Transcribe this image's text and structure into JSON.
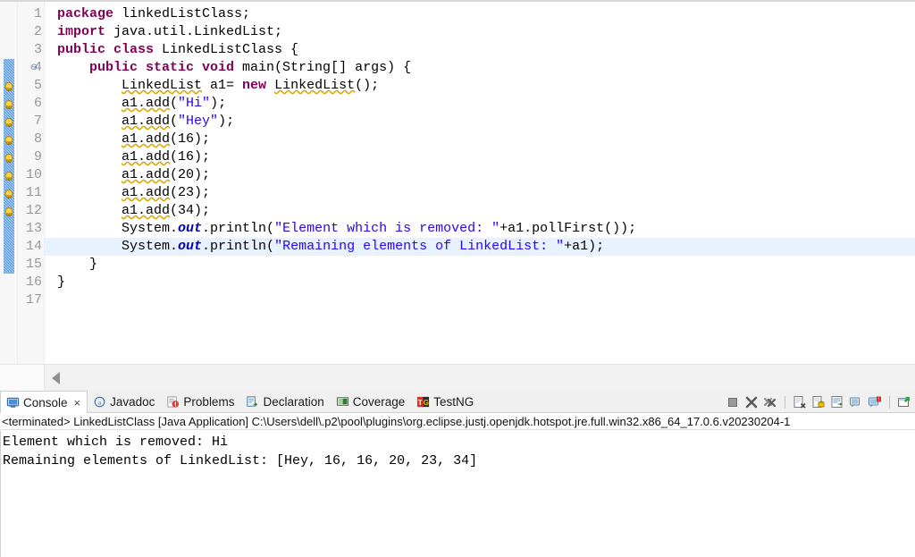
{
  "editor": {
    "name": "java-code-editor",
    "current_line": 14,
    "change_bar": {
      "from_line": 4,
      "to_line": 15
    },
    "warning_lines": [
      5,
      6,
      7,
      8,
      9,
      10,
      11,
      12
    ],
    "fold_marker_line": 4,
    "fold_marker_glyph": "⊖",
    "line_numbers": [
      "1",
      "2",
      "3",
      "4",
      "5",
      "6",
      "7",
      "8",
      "9",
      "10",
      "11",
      "12",
      "13",
      "14",
      "15",
      "16",
      "17"
    ],
    "lines": [
      {
        "n": 1,
        "tokens": [
          {
            "t": "package ",
            "c": "kw"
          },
          {
            "t": "linkedListClass;",
            "c": "plain"
          }
        ]
      },
      {
        "n": 2,
        "tokens": [
          {
            "t": "import ",
            "c": "kw"
          },
          {
            "t": "java.util.LinkedList;",
            "c": "plain"
          }
        ]
      },
      {
        "n": 3,
        "tokens": [
          {
            "t": "public class ",
            "c": "kw"
          },
          {
            "t": "LinkedListClass {",
            "c": "plain"
          }
        ]
      },
      {
        "n": 4,
        "tokens": [
          {
            "t": "    ",
            "c": "plain"
          },
          {
            "t": "public static void ",
            "c": "kw"
          },
          {
            "t": "main(String[] args) {",
            "c": "plain"
          }
        ]
      },
      {
        "n": 5,
        "tokens": [
          {
            "t": "        ",
            "c": "plain"
          },
          {
            "t": "LinkedList",
            "c": "plain warn-u"
          },
          {
            "t": " a1= ",
            "c": "plain"
          },
          {
            "t": "new ",
            "c": "kw"
          },
          {
            "t": "LinkedList",
            "c": "plain warn-u"
          },
          {
            "t": "();",
            "c": "plain"
          }
        ]
      },
      {
        "n": 6,
        "tokens": [
          {
            "t": "        ",
            "c": "plain"
          },
          {
            "t": "a1.add",
            "c": "plain warn-u"
          },
          {
            "t": "(",
            "c": "plain"
          },
          {
            "t": "\"Hi\"",
            "c": "str"
          },
          {
            "t": ");",
            "c": "plain"
          }
        ]
      },
      {
        "n": 7,
        "tokens": [
          {
            "t": "        ",
            "c": "plain"
          },
          {
            "t": "a1.add",
            "c": "plain warn-u"
          },
          {
            "t": "(",
            "c": "plain"
          },
          {
            "t": "\"Hey\"",
            "c": "str"
          },
          {
            "t": ");",
            "c": "plain"
          }
        ]
      },
      {
        "n": 8,
        "tokens": [
          {
            "t": "        ",
            "c": "plain"
          },
          {
            "t": "a1.add",
            "c": "plain warn-u"
          },
          {
            "t": "(16);",
            "c": "plain"
          }
        ]
      },
      {
        "n": 9,
        "tokens": [
          {
            "t": "        ",
            "c": "plain"
          },
          {
            "t": "a1.add",
            "c": "plain warn-u"
          },
          {
            "t": "(16);",
            "c": "plain"
          }
        ]
      },
      {
        "n": 10,
        "tokens": [
          {
            "t": "        ",
            "c": "plain"
          },
          {
            "t": "a1.add",
            "c": "plain warn-u"
          },
          {
            "t": "(20);",
            "c": "plain"
          }
        ]
      },
      {
        "n": 11,
        "tokens": [
          {
            "t": "        ",
            "c": "plain"
          },
          {
            "t": "a1.add",
            "c": "plain warn-u"
          },
          {
            "t": "(23);",
            "c": "plain"
          }
        ]
      },
      {
        "n": 12,
        "tokens": [
          {
            "t": "        ",
            "c": "plain"
          },
          {
            "t": "a1.add",
            "c": "plain warn-u"
          },
          {
            "t": "(34);",
            "c": "plain"
          }
        ]
      },
      {
        "n": 13,
        "tokens": [
          {
            "t": "        System.",
            "c": "plain"
          },
          {
            "t": "out",
            "c": "fld"
          },
          {
            "t": ".println(",
            "c": "plain"
          },
          {
            "t": "\"Element which is removed: \"",
            "c": "str"
          },
          {
            "t": "+a1.pollFirst());",
            "c": "plain"
          }
        ]
      },
      {
        "n": 14,
        "tokens": [
          {
            "t": "        System.",
            "c": "plain"
          },
          {
            "t": "out",
            "c": "fld"
          },
          {
            "t": ".println(",
            "c": "plain"
          },
          {
            "t": "\"Remaining elements of LinkedList: \"",
            "c": "str"
          },
          {
            "t": "+a1);",
            "c": "plain"
          }
        ]
      },
      {
        "n": 15,
        "tokens": [
          {
            "t": "    }",
            "c": "plain"
          }
        ]
      },
      {
        "n": 16,
        "tokens": [
          {
            "t": "}",
            "c": "plain"
          }
        ]
      },
      {
        "n": 17,
        "tokens": [
          {
            "t": "",
            "c": "plain"
          }
        ]
      }
    ],
    "colors": {
      "keyword": "#7F0055",
      "string": "#2A00FF",
      "field": "#0000C0",
      "warning_underline": "#D9A300",
      "current_line_bg": "#E8F2FE",
      "change_bar": "#5C9FE0"
    }
  },
  "console": {
    "tabs": [
      {
        "label": "Console",
        "icon": "console-icon",
        "active": true,
        "closable": true
      },
      {
        "label": "Javadoc",
        "icon": "javadoc-icon",
        "active": false,
        "closable": false
      },
      {
        "label": "Problems",
        "icon": "problems-icon",
        "active": false,
        "closable": false
      },
      {
        "label": "Declaration",
        "icon": "declaration-icon",
        "active": false,
        "closable": false
      },
      {
        "label": "Coverage",
        "icon": "coverage-icon",
        "active": false,
        "closable": false
      },
      {
        "label": "TestNG",
        "icon": "testng-icon",
        "active": false,
        "closable": false
      }
    ],
    "close_glyph": "×",
    "toolbar_icons": [
      "terminate-icon",
      "remove-launch-icon",
      "remove-all-terminated-icon",
      "clear-console-icon",
      "scroll-lock-icon",
      "word-wrap-icon",
      "show-console-on-output-icon",
      "show-console-on-error-icon",
      "open-console-icon"
    ],
    "process_line": "<terminated> LinkedListClass [Java Application] C:\\Users\\dell\\.p2\\pool\\plugins\\org.eclipse.justj.openjdk.hotspot.jre.full.win32.x86_64_17.0.6.v20230204-1",
    "output": [
      "Element which is removed: Hi",
      "Remaining elements of LinkedList: [Hey, 16, 16, 20, 23, 34]"
    ]
  }
}
